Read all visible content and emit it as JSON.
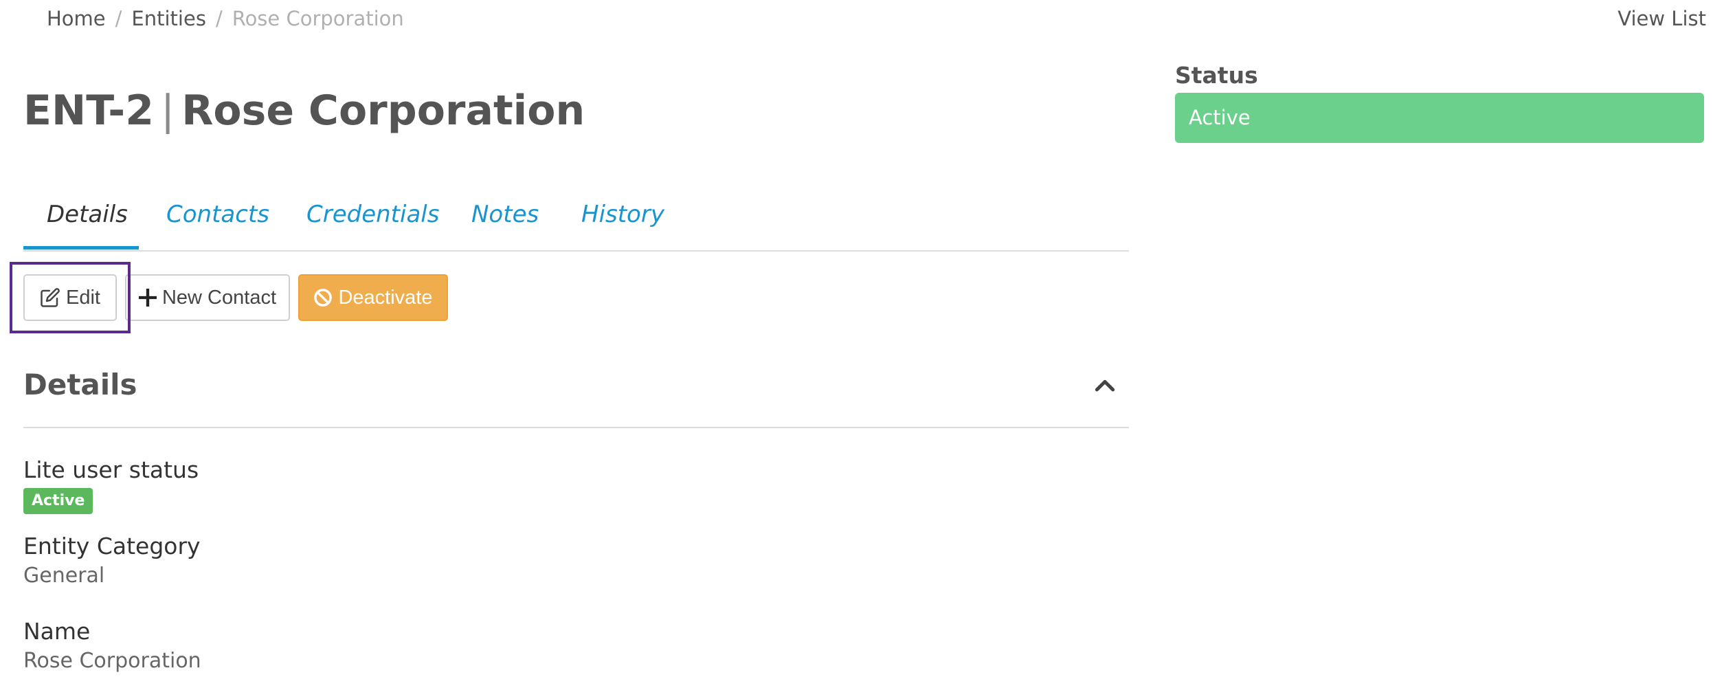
{
  "breadcrumb": {
    "items": [
      "Home",
      "Entities",
      "Rose Corporation"
    ],
    "separator": "/"
  },
  "header": {
    "view_list": "View List",
    "entity_id": "ENT-2",
    "pipe": "|",
    "entity_name": "Rose Corporation"
  },
  "status": {
    "label": "Status",
    "value": "Active",
    "color": "#6bd08c"
  },
  "tabs": [
    {
      "label": "Details",
      "active": true
    },
    {
      "label": "Contacts",
      "active": false
    },
    {
      "label": "Credentials",
      "active": false
    },
    {
      "label": "Notes",
      "active": false
    },
    {
      "label": "History",
      "active": false
    }
  ],
  "actions": {
    "edit_label": "Edit",
    "new_contact_label": "New Contact",
    "deactivate_label": "Deactivate",
    "edit_icon": "edit-icon",
    "new_contact_icon": "plus-icon",
    "deactivate_icon": "ban-icon",
    "highlight_color": "#5b2a8e",
    "deactivate_color": "#f0ad4e"
  },
  "details": {
    "title": "Details",
    "collapse_icon": "chevron-up-icon",
    "fields": {
      "lite_user_status": {
        "label": "Lite user status",
        "value": "Active",
        "badge_color": "#5cb85c"
      },
      "entity_category": {
        "label": "Entity Category",
        "value": "General"
      },
      "name": {
        "label": "Name",
        "value": "Rose Corporation"
      }
    }
  },
  "colors": {
    "accent": "#1a94cf",
    "text": "#444444"
  }
}
